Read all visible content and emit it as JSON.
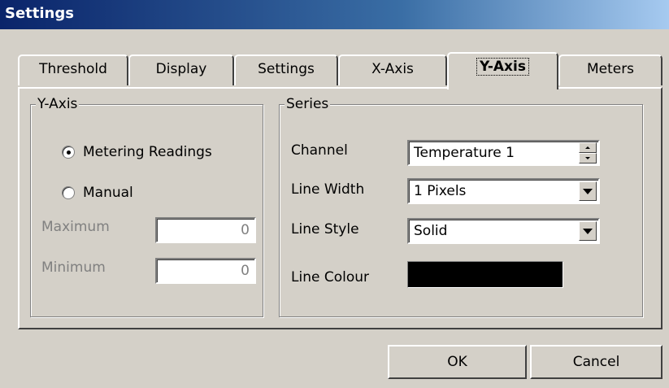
{
  "window": {
    "title": "Settings"
  },
  "tabs": [
    {
      "label": "Threshold",
      "active": false
    },
    {
      "label": "Display",
      "active": false
    },
    {
      "label": "Settings",
      "active": false
    },
    {
      "label": "X-Axis",
      "active": false
    },
    {
      "label": "Y-Axis",
      "active": true
    },
    {
      "label": "Meters",
      "active": false
    }
  ],
  "yaxis_group": {
    "legend": "Y-Axis",
    "mode_options": [
      {
        "label": "Metering Readings",
        "selected": true
      },
      {
        "label": "Manual",
        "selected": false
      }
    ],
    "maximum": {
      "label": "Maximum",
      "value": "0",
      "enabled": false
    },
    "minimum": {
      "label": "Minimum",
      "value": "0",
      "enabled": false
    }
  },
  "series_group": {
    "legend": "Series",
    "channel": {
      "label": "Channel",
      "value": "Temperature 1"
    },
    "line_width": {
      "label": "Line Width",
      "value": "1 Pixels"
    },
    "line_style": {
      "label": "Line Style",
      "value": "Solid"
    },
    "line_colour": {
      "label": "Line Colour",
      "color": "#000000"
    }
  },
  "buttons": {
    "ok": "OK",
    "cancel": "Cancel"
  },
  "colors": {
    "face": "#d4d0c8",
    "title_start": "#0a246a",
    "title_end": "#a6caf0"
  }
}
